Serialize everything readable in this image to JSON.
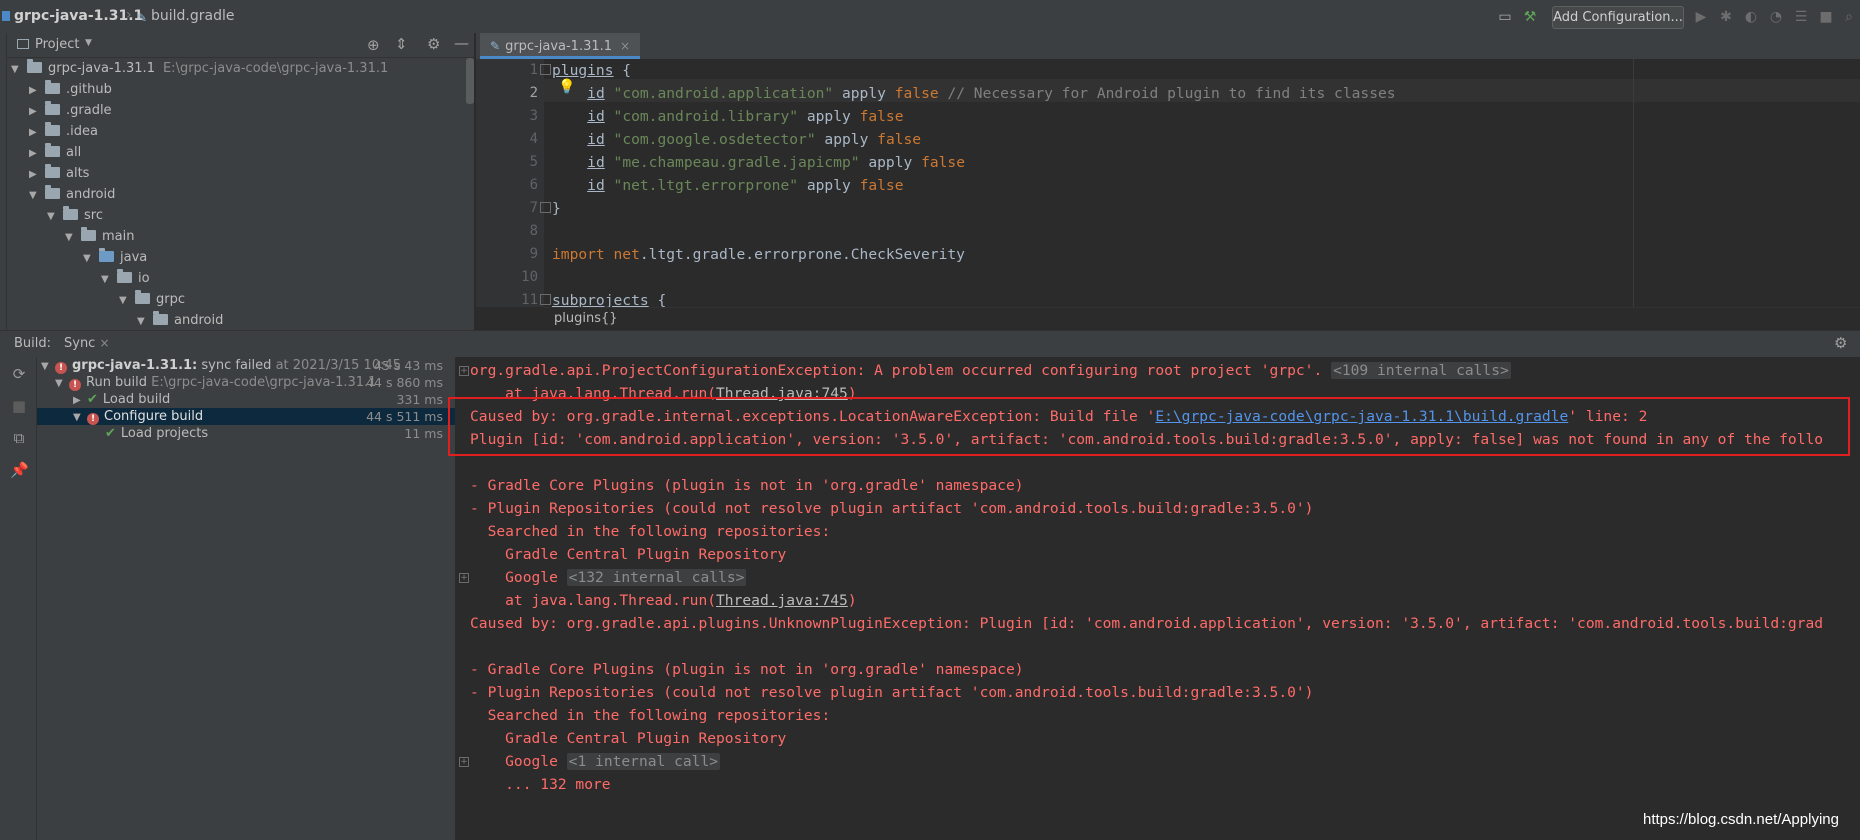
{
  "nav": {
    "project": "grpc-java-1.31.1",
    "file": "build.gradle",
    "add_config": "Add Configuration..."
  },
  "project_panel": {
    "title": "Project",
    "root": {
      "name": "grpc-java-1.31.1",
      "path": "E:\\grpc-java-code\\grpc-java-1.31.1"
    },
    "items": [
      ".github",
      ".gradle",
      ".idea",
      "all",
      "alts",
      "android",
      "src",
      "main",
      "java",
      "io",
      "grpc",
      "android"
    ]
  },
  "editor": {
    "tab": "grpc-java-1.31.1",
    "line_numbers": [
      "1",
      "2",
      "3",
      "4",
      "5",
      "6",
      "7",
      "8",
      "9",
      "10",
      "11"
    ],
    "plugins_kw": "plugins",
    "open_brace": " {",
    "close_brace": "}",
    "id_kw": "id",
    "apply_kw": "apply",
    "false_kw": "false",
    "plugin_ids": [
      "\"com.android.application\"",
      "\"com.android.library\"",
      "\"com.google.osdetector\"",
      "\"me.champeau.gradle.japicmp\"",
      "\"net.ltgt.errorprone\""
    ],
    "comment": "// Necessary for Android plugin to find its classes",
    "import_kw": "import",
    "import_pkg": "net",
    "import_rest": ".ltgt.gradle.errorprone.CheckSeverity",
    "subprojects_kw": "subprojects",
    "breadcrumb": "plugins{}"
  },
  "build": {
    "label": "Build:",
    "tab": "Sync",
    "tree": {
      "root": {
        "name": "grpc-java-1.31.1:",
        "status": "sync failed",
        "at": "at 2021/3/15 10:45",
        "time": "45 s 43 ms"
      },
      "run_build": {
        "name": "Run build",
        "path": "E:\\grpc-java-code\\grpc-java-1.31.1",
        "time": "44 s 860 ms"
      },
      "load_build": {
        "name": "Load build",
        "time": "331 ms"
      },
      "configure_build": {
        "name": "Configure build",
        "time": "44 s 511 ms"
      },
      "load_projects": {
        "name": "Load projects",
        "time": "11 ms"
      }
    },
    "console": {
      "l1": "org.gradle.api.ProjectConfigurationException: A problem occurred configuring root project 'grpc'.",
      "l1_calls": "<109 internal calls>",
      "l2_pre": "    at java.lang.Thread.run(",
      "l2_link": "Thread.java:745",
      "l2_post": ")",
      "l3_pre": "Caused by: org.gradle.internal.exceptions.LocationAwareException: Build file '",
      "l3_link": "E:\\grpc-java-code\\grpc-java-1.31.1\\build.gradle",
      "l3_post": "' line: 2",
      "l4": "Plugin [id: 'com.android.application', version: '3.5.0', artifact: 'com.android.tools.build:gradle:3.5.0', apply: false] was not found in any of the follo",
      "l6": "- Gradle Core Plugins (plugin is not in 'org.gradle' namespace)",
      "l7": "- Plugin Repositories (could not resolve plugin artifact 'com.android.tools.build:gradle:3.5.0')",
      "l8": "  Searched in the following repositories:",
      "l9": "    Gradle Central Plugin Repository",
      "l10_pre": "    Google",
      "l10_calls": "<132 internal calls>",
      "l11_pre": "    at java.lang.Thread.run(",
      "l11_link": "Thread.java:745",
      "l11_post": ")",
      "l12": "Caused by: org.gradle.api.plugins.UnknownPluginException: Plugin [id: 'com.android.application', version: '3.5.0', artifact: 'com.android.tools.build:grad",
      "l14": "- Gradle Core Plugins (plugin is not in 'org.gradle' namespace)",
      "l15": "- Plugin Repositories (could not resolve plugin artifact 'com.android.tools.build:gradle:3.5.0')",
      "l16": "  Searched in the following repositories:",
      "l17": "    Gradle Central Plugin Repository",
      "l18_pre": "    Google",
      "l18_calls": "<1 internal call>",
      "l19": "    ... 132 more"
    }
  },
  "watermark": "https://blog.csdn.net/Applying"
}
